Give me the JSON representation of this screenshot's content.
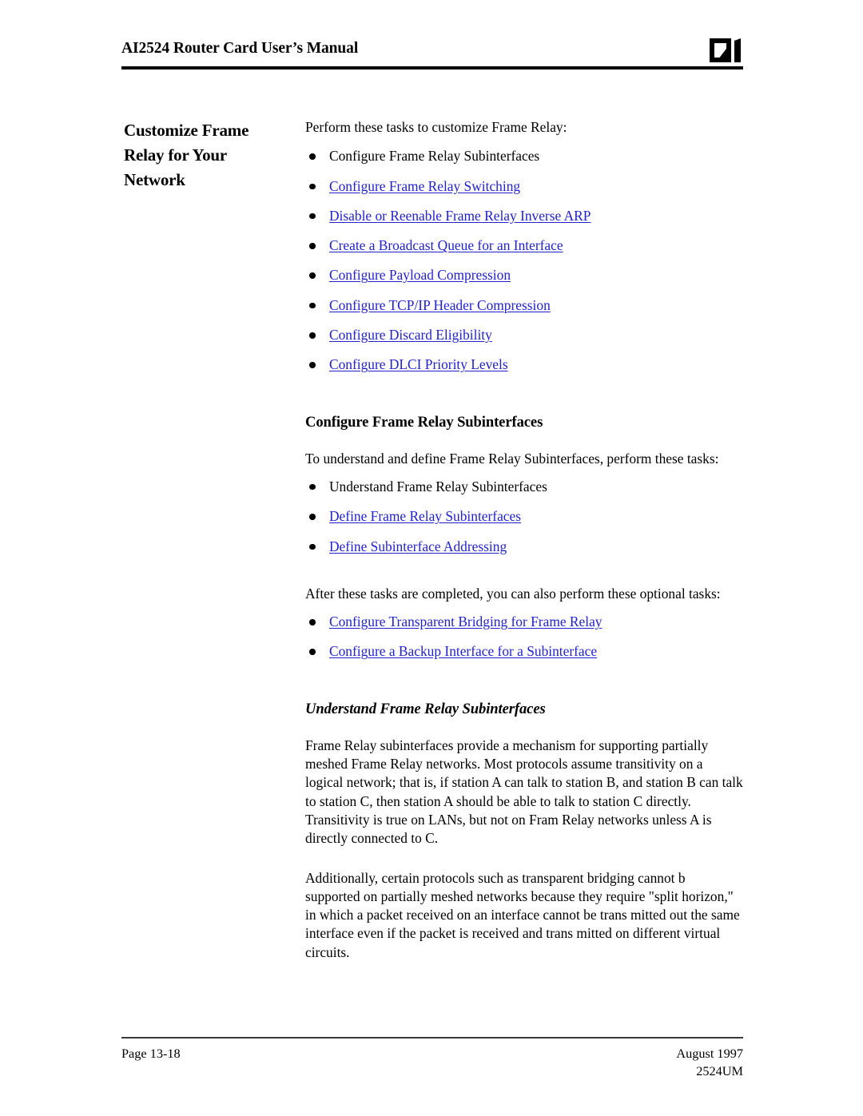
{
  "header": {
    "title": "AI2524 Router Card User’s Manual",
    "logo_name": "ai-logo"
  },
  "side_heading": {
    "lines": [
      "Customize Frame",
      "Relay for Your",
      "Network"
    ],
    "text": "Customize Frame Relay for Your Network"
  },
  "body": {
    "intro": "Perform these tasks to customize Frame Relay:",
    "task_list": [
      {
        "label": "Configure Frame Relay Subinterfaces",
        "is_link": false
      },
      {
        "label": "Configure Frame Relay Switching",
        "is_link": true
      },
      {
        "label": "Disable or Reenable Frame Relay Inverse ARP",
        "is_link": true
      },
      {
        "label": "Create a Broadcast Queue for an Interface",
        "is_link": true
      },
      {
        "label": "Configure Payload Compression",
        "is_link": true
      },
      {
        "label": "Configure TCP/IP Header Compression",
        "is_link": true
      },
      {
        "label": "Configure Discard Eligibility",
        "is_link": true
      },
      {
        "label": "Configure DLCI Priority Levels",
        "is_link": true
      }
    ],
    "section_heading": "Configure Frame Relay Subinterfaces",
    "section_intro": "To understand and define Frame Relay Subinterfaces, perform these tasks:",
    "subinterface_list": [
      {
        "label": "Understand Frame Relay Subinterfaces",
        "is_link": false
      },
      {
        "label": "Define Frame Relay Subinterfaces",
        "is_link": true
      },
      {
        "label": "Define Subinterface Addressing",
        "is_link": true
      }
    ],
    "optional_intro": "After these tasks are completed, you can also perform these optional tasks:",
    "optional_list": [
      {
        "label": "Configure Transparent Bridging for Frame Relay",
        "is_link": true
      },
      {
        "label": "Configure a Backup Interface for a Subinterface ",
        "is_link": true
      }
    ],
    "understand_heading": "Understand Frame Relay Subinterfaces",
    "paragraph_1": "Frame Relay subinterfaces provide a mechanism for supporting partially meshed Frame Relay networks. Most protocols assume transitivity on a logical network; that is, if station A can talk to station B, and station B can talk to station C, then station A should be able to talk to station C directly. Transitivity is true on LANs, but not on Fram Relay networks unless A is directly connected to C.",
    "paragraph_2": "Additionally, certain protocols such as transparent bridging cannot b supported on partially meshed networks because they require \"split horizon,\" in which a packet received on an interface cannot be trans mitted out the same interface even if the packet is received and trans mitted on different virtual circuits."
  },
  "footer": {
    "page_number": "Page 13-18",
    "date": "August 1997",
    "doc_code": "2524UM"
  },
  "colors": {
    "link": "#2222cc",
    "text": "#000000",
    "rule": "#000000"
  }
}
